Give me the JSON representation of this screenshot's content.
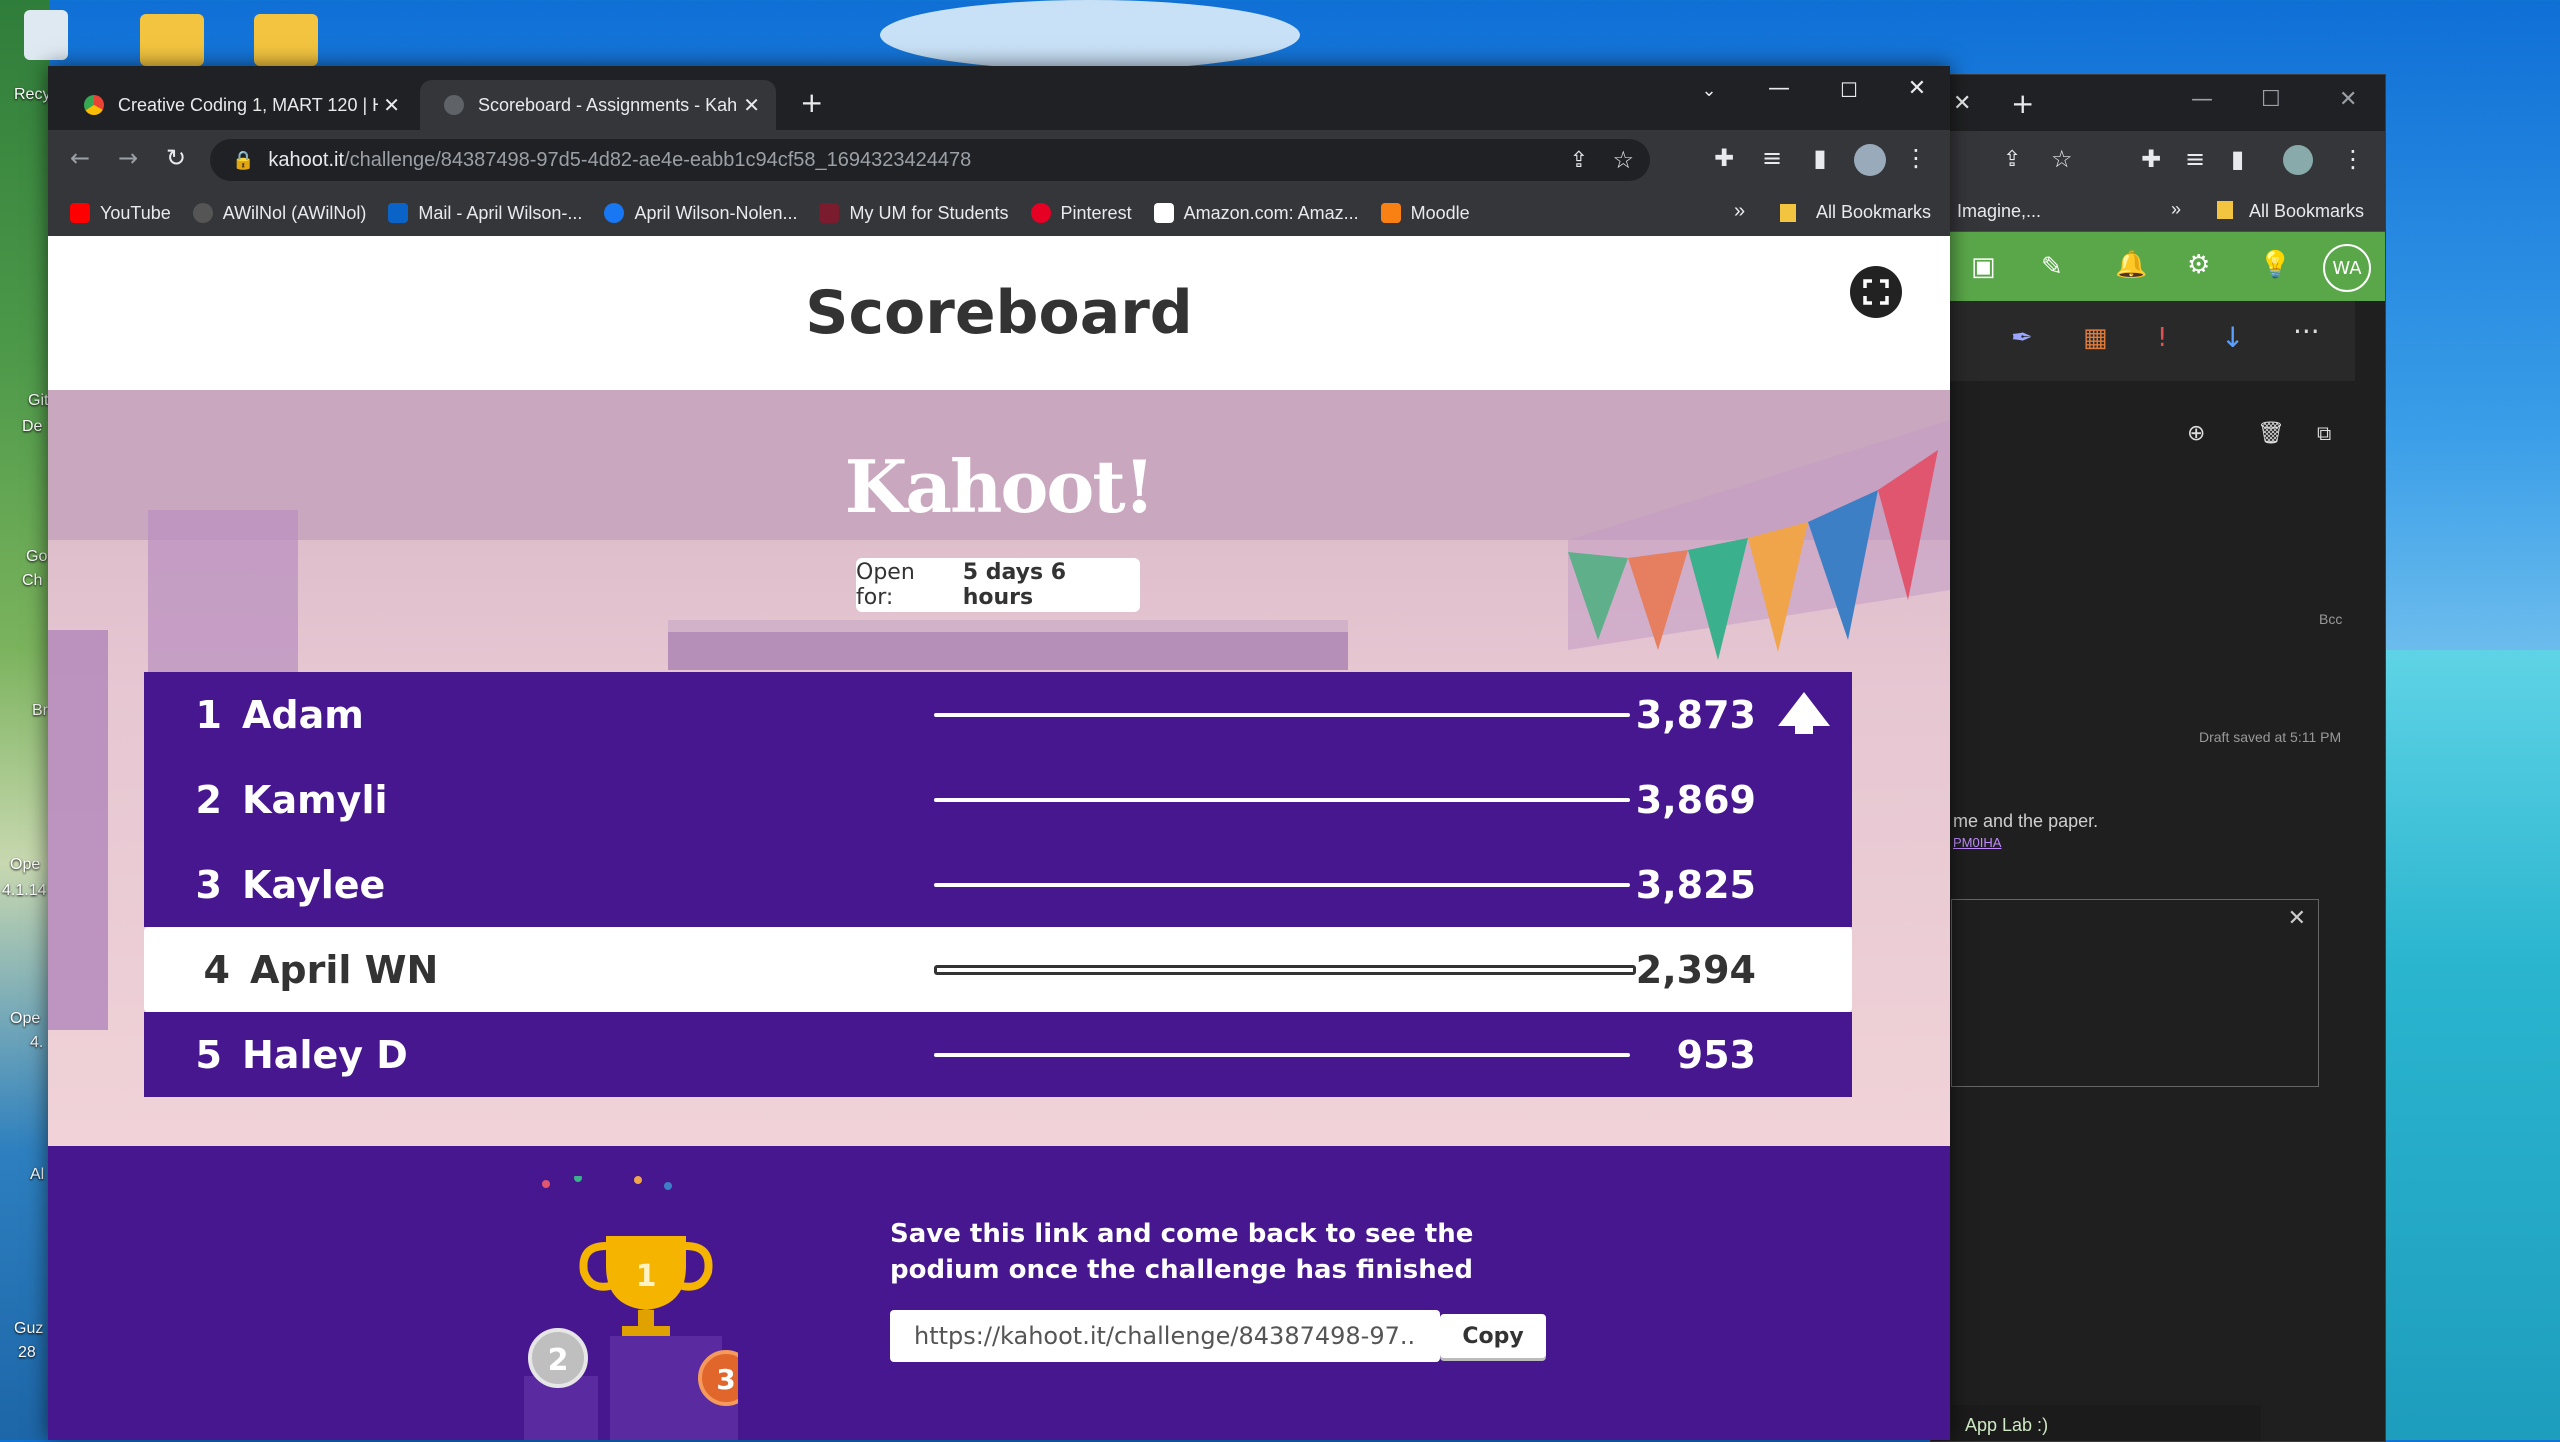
{
  "browser": {
    "tabs": [
      {
        "title": "Creative Coding 1, MART 120 | H",
        "active": false
      },
      {
        "title": "Scoreboard - Assignments - Kah",
        "active": true
      }
    ],
    "url_host": "kahoot.it",
    "url_path": "/challenge/84387498-97d5-4d82-ae4e-eabb1c94cf58_1694323424478",
    "bookmarks": [
      {
        "label": "YouTube",
        "color": "#ff0000"
      },
      {
        "label": "AWilNol (AWilNol)",
        "color": "#555555"
      },
      {
        "label": "Mail - April Wilson-...",
        "color": "#0a64c8"
      },
      {
        "label": "April Wilson-Nolen...",
        "color": "#1877f2"
      },
      {
        "label": "My UM for Students",
        "color": "#7a1c2e"
      },
      {
        "label": "Pinterest",
        "color": "#e60023"
      },
      {
        "label": "Amazon.com: Amaz...",
        "color": "#ffffff"
      },
      {
        "label": "Moodle",
        "color": "#f98012"
      }
    ],
    "more_label": "»",
    "all_bookmarks": "All Bookmarks"
  },
  "back_window": {
    "bookmark_partial": "Imagine,...",
    "more_label": "»",
    "all_bookmarks": "All Bookmarks",
    "avatar": "WA",
    "bcc": "Bcc",
    "draft_saved": "Draft saved at 5:11 PM",
    "body_text": "me and the paper.",
    "link_fragment": "PM0IHA",
    "taskbar_item": "App Lab :)"
  },
  "page": {
    "title": "Scoreboard",
    "brand": "Kahoot!",
    "open_for_label": "Open for:",
    "open_for_value": "5 days 6 hours",
    "leaderboard": [
      {
        "rank": "1",
        "name": "Adam",
        "score": "3,873",
        "fraction": 1.0
      },
      {
        "rank": "2",
        "name": "Kamyli",
        "score": "3,869",
        "fraction": 1.0
      },
      {
        "rank": "3",
        "name": "Kaylee",
        "score": "3,825",
        "fraction": 1.0
      },
      {
        "rank": "4",
        "name": "April WN",
        "score": "2,394",
        "fraction": 1.0
      },
      {
        "rank": "5",
        "name": "Haley D",
        "score": "953",
        "fraction": 1.0
      }
    ],
    "save_message": "Save this link and come back to see the podium once the challenge has finished",
    "share_link": "https://kahoot.it/challenge/84387498-97...",
    "copy_label": "Copy",
    "podium": [
      "1",
      "2",
      "3"
    ]
  },
  "desktop": {
    "labels": [
      "Recy",
      "Git",
      "De",
      "Go",
      "Ch",
      "Br",
      "Ope",
      "4.1.14",
      "Ope",
      "4.",
      "Al",
      "Guz",
      "28"
    ]
  },
  "colors": {
    "kahoot_purple": "#46178f",
    "chrome_dark": "#202124",
    "chrome_toolbar": "#35363a",
    "outlook_green": "#5aa74a"
  }
}
